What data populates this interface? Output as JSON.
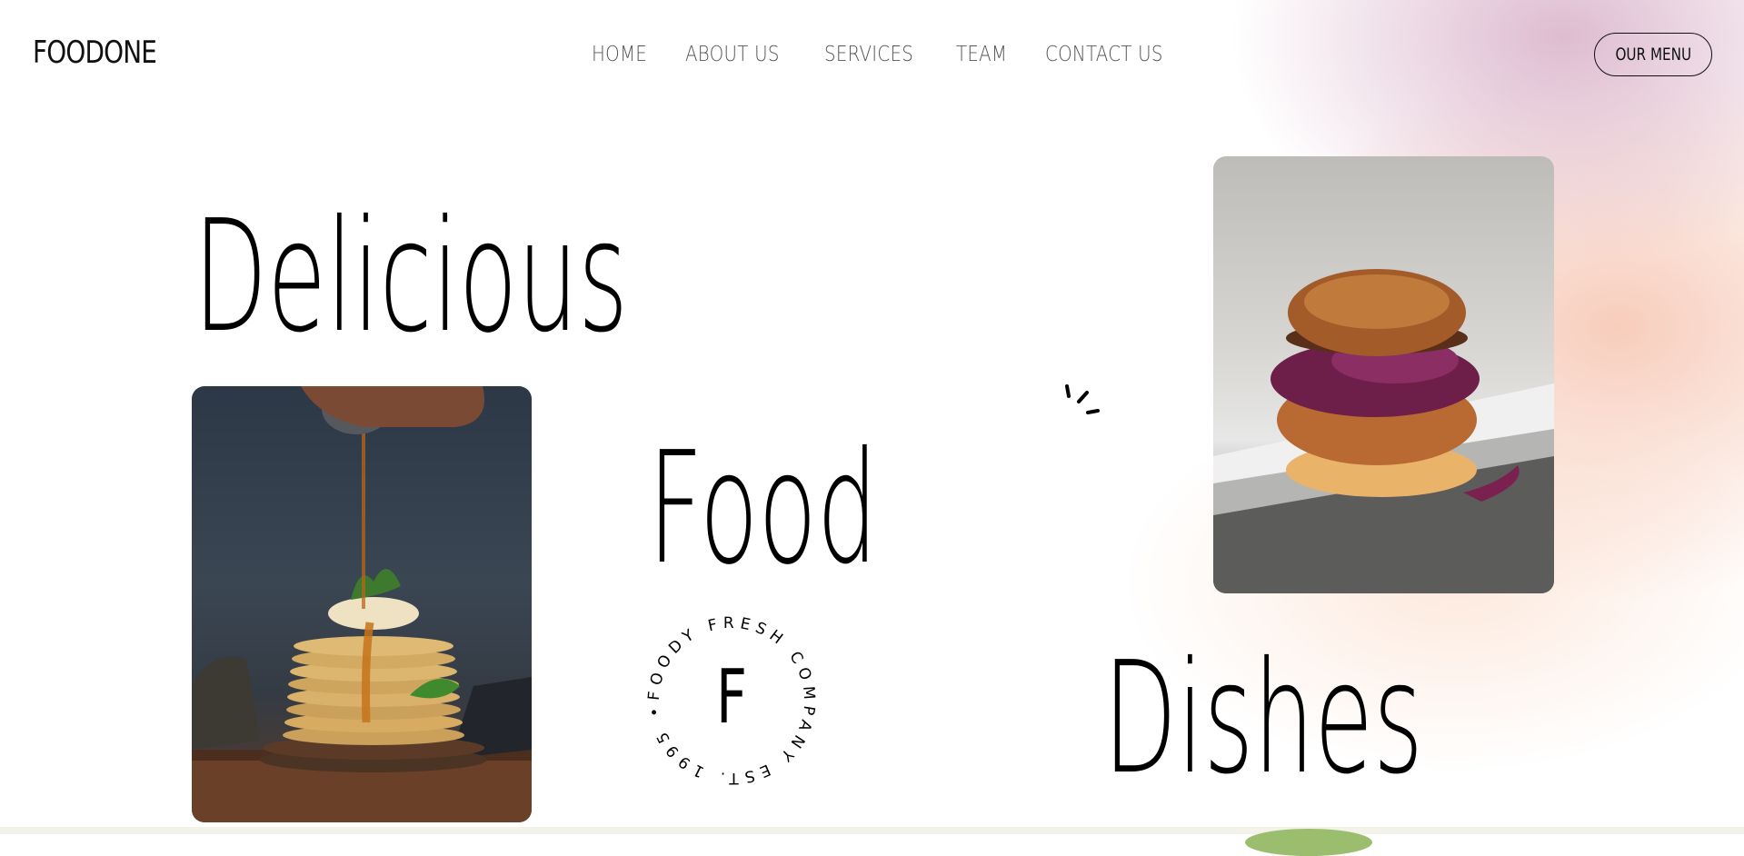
{
  "brand": {
    "logo": "FOODONE"
  },
  "nav": {
    "items": [
      {
        "label": "HOME"
      },
      {
        "label": "ABOUT US"
      },
      {
        "label": "SERVICES"
      },
      {
        "label": "TEAM"
      },
      {
        "label": "CONTACT US"
      }
    ]
  },
  "header": {
    "menu_button": "OUR MENU"
  },
  "hero": {
    "words": [
      "Delicious",
      "Food",
      "Dishes"
    ]
  },
  "badge": {
    "letter": "F",
    "ring_text": "FOODY FRESH COMPANY EST. 1995 •"
  },
  "images": {
    "pancakes": "pancake stack with syrup",
    "burger": "fried chicken burger with purple slaw"
  },
  "icons": {
    "spark": "spark-lines-icon"
  },
  "colors": {
    "text": "#000000",
    "nav_text": "#555555",
    "gradient_pink": "#d8b0c8",
    "gradient_peach": "#f6c4b0"
  }
}
